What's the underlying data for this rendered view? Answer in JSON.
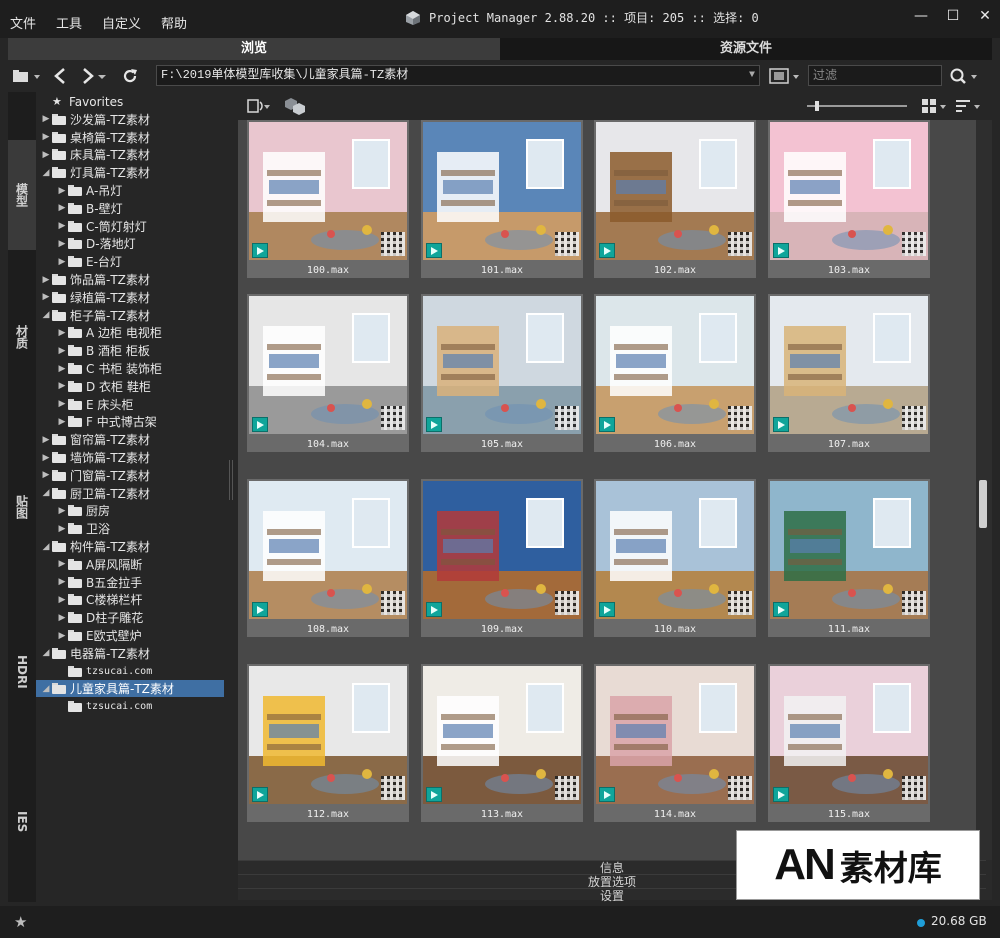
{
  "menu": [
    "文件",
    "工具",
    "自定义",
    "帮助"
  ],
  "app": {
    "title": "Project Manager 2.88.20  :: 项目: 205  :: 选择: 0"
  },
  "window_controls": {
    "minimize": "—",
    "restore": "☐",
    "close": "✕"
  },
  "tabs": [
    "浏览",
    "资源文件"
  ],
  "toolbar": {
    "path": "F:\\2019单体模型库收集\\儿童家具篇-TZ素材",
    "filter_placeholder": "过滤"
  },
  "vertical_tabs": [
    "模型",
    "材质",
    "贴图",
    "HDRI",
    "IES"
  ],
  "tree": [
    {
      "label": "Favorites",
      "depth": 0,
      "type": "star"
    },
    {
      "label": "沙发篇-TZ素材",
      "depth": 0,
      "type": "folder",
      "arrow": "▶"
    },
    {
      "label": "桌椅篇-TZ素材",
      "depth": 0,
      "type": "folder",
      "arrow": "▶"
    },
    {
      "label": "床具篇-TZ素材",
      "depth": 0,
      "type": "folder",
      "arrow": "▶"
    },
    {
      "label": "灯具篇-TZ素材",
      "depth": 0,
      "type": "folder",
      "arrow": "◢"
    },
    {
      "label": "A-吊灯",
      "depth": 1,
      "type": "folder",
      "arrow": "▶"
    },
    {
      "label": "B-壁灯",
      "depth": 1,
      "type": "folder",
      "arrow": "▶"
    },
    {
      "label": "C-筒灯射灯",
      "depth": 1,
      "type": "folder",
      "arrow": "▶"
    },
    {
      "label": "D-落地灯",
      "depth": 1,
      "type": "folder",
      "arrow": "▶"
    },
    {
      "label": "E-台灯",
      "depth": 1,
      "type": "folder",
      "arrow": "▶"
    },
    {
      "label": "饰品篇-TZ素材",
      "depth": 0,
      "type": "folder",
      "arrow": "▶"
    },
    {
      "label": "绿植篇-TZ素材",
      "depth": 0,
      "type": "folder",
      "arrow": "▶"
    },
    {
      "label": "柜子篇-TZ素材",
      "depth": 0,
      "type": "folder",
      "arrow": "◢"
    },
    {
      "label": "A 边柜 电视柜",
      "depth": 1,
      "type": "folder",
      "arrow": "▶"
    },
    {
      "label": "B 酒柜 柜板",
      "depth": 1,
      "type": "folder",
      "arrow": "▶"
    },
    {
      "label": "C 书柜 装饰柜",
      "depth": 1,
      "type": "folder",
      "arrow": "▶"
    },
    {
      "label": "D 衣柜 鞋柜",
      "depth": 1,
      "type": "folder",
      "arrow": "▶"
    },
    {
      "label": "E 床头柜",
      "depth": 1,
      "type": "folder",
      "arrow": "▶"
    },
    {
      "label": "F 中式博古架",
      "depth": 1,
      "type": "folder",
      "arrow": "▶"
    },
    {
      "label": "窗帘篇-TZ素材",
      "depth": 0,
      "type": "folder",
      "arrow": "▶"
    },
    {
      "label": "墙饰篇-TZ素材",
      "depth": 0,
      "type": "folder",
      "arrow": "▶"
    },
    {
      "label": "门窗篇-TZ素材",
      "depth": 0,
      "type": "folder",
      "arrow": "▶"
    },
    {
      "label": "厨卫篇-TZ素材",
      "depth": 0,
      "type": "folder",
      "arrow": "◢"
    },
    {
      "label": "厨房",
      "depth": 1,
      "type": "folder",
      "arrow": "▶"
    },
    {
      "label": "卫浴",
      "depth": 1,
      "type": "folder",
      "arrow": "▶"
    },
    {
      "label": "构件篇-TZ素材",
      "depth": 0,
      "type": "folder",
      "arrow": "◢"
    },
    {
      "label": "A屏风隔断",
      "depth": 1,
      "type": "folder",
      "arrow": "▶"
    },
    {
      "label": "B五金拉手",
      "depth": 1,
      "type": "folder",
      "arrow": "▶"
    },
    {
      "label": "C楼梯栏杆",
      "depth": 1,
      "type": "folder",
      "arrow": "▶"
    },
    {
      "label": "D柱子雕花",
      "depth": 1,
      "type": "folder",
      "arrow": "▶"
    },
    {
      "label": "E欧式壁炉",
      "depth": 1,
      "type": "folder",
      "arrow": "▶"
    },
    {
      "label": "电器篇-TZ素材",
      "depth": 0,
      "type": "folder",
      "arrow": "◢"
    },
    {
      "label": "tzsucai.com",
      "depth": 1,
      "type": "folder",
      "arrow": "",
      "small": true
    },
    {
      "label": "儿童家具篇-TZ素材",
      "depth": 0,
      "type": "folder",
      "arrow": "◢",
      "selected": true
    },
    {
      "label": "tzsucai.com",
      "depth": 1,
      "type": "folder",
      "arrow": "",
      "small": true
    }
  ],
  "items": [
    {
      "name": "100.max",
      "wall": "#e9c6cf",
      "floor": "#b08860",
      "accent": "#ffffff"
    },
    {
      "name": "101.max",
      "wall": "#5a86b8",
      "floor": "#c69a6a",
      "accent": "#ffffff"
    },
    {
      "name": "102.max",
      "wall": "#e7e7ea",
      "floor": "#a37a52",
      "accent": "#8b5a2b"
    },
    {
      "name": "103.max",
      "wall": "#f3c2d2",
      "floor": "#d8b4b8",
      "accent": "#ffffff"
    },
    {
      "name": "104.max",
      "wall": "#e6e6e6",
      "floor": "#9a9a9a",
      "accent": "#ffffff"
    },
    {
      "name": "105.max",
      "wall": "#cfd8e0",
      "floor": "#8aa0ad",
      "accent": "#d9b27a"
    },
    {
      "name": "106.max",
      "wall": "#dce6ea",
      "floor": "#c8a06f",
      "accent": "#ffffff"
    },
    {
      "name": "107.max",
      "wall": "#e4e9ee",
      "floor": "#b8aa92",
      "accent": "#d8b478"
    },
    {
      "name": "108.max",
      "wall": "#dfeaf2",
      "floor": "#b58d62",
      "accent": "#ffffff"
    },
    {
      "name": "109.max",
      "wall": "#2f5f9f",
      "floor": "#a36a3a",
      "accent": "#b33a3a"
    },
    {
      "name": "110.max",
      "wall": "#a9c2d8",
      "floor": "#b3884f",
      "accent": "#ffffff"
    },
    {
      "name": "111.max",
      "wall": "#8fb6cc",
      "floor": "#a57c55",
      "accent": "#2e6e45"
    },
    {
      "name": "112.max",
      "wall": "#e8e8e8",
      "floor": "#8a6a48",
      "accent": "#f0b830"
    },
    {
      "name": "113.max",
      "wall": "#efece6",
      "floor": "#7c5a3e",
      "accent": "#ffffff"
    },
    {
      "name": "114.max",
      "wall": "#e8dbd4",
      "floor": "#9a6e50",
      "accent": "#d9a3a8"
    },
    {
      "name": "115.max",
      "wall": "#ead0da",
      "floor": "#7a5a45",
      "accent": "#f2f2f2"
    }
  ],
  "bottom_panel": [
    "信息",
    "放置选项",
    "设置"
  ],
  "watermark": {
    "an": "AN",
    "cn": "素材库"
  },
  "status": {
    "size": "20.68 GB"
  },
  "colors": {
    "selection": "#3f6fa3",
    "max_icon": "#10a59a",
    "status_dot": "#1f9ed8"
  }
}
